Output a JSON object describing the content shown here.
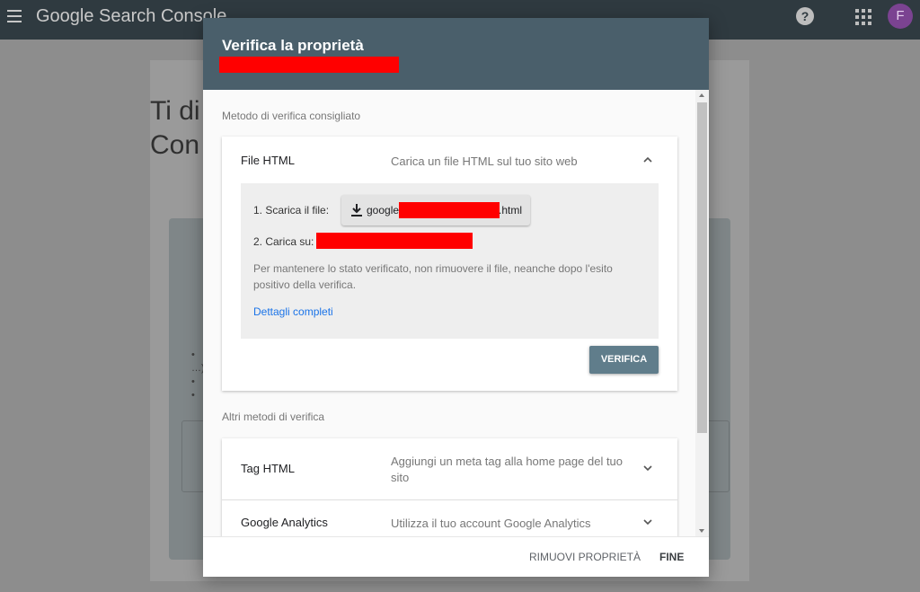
{
  "app": {
    "title": "Google Search Console",
    "avatar_letter": "F",
    "help_glyph": "?"
  },
  "background": {
    "heading_line1": "Ti di",
    "heading_line2": "Con"
  },
  "dialog": {
    "title": "Verifica la proprietà",
    "recommended_label": "Metodo di verifica consigliato",
    "other_label": "Altri metodi di verifica",
    "html_file": {
      "name": "File HTML",
      "description": "Carica un file HTML sul tuo sito web",
      "step1_label": "1. Scarica il file:",
      "download_prefix": "google",
      "download_suffix": ".html",
      "step2_label": "2. Carica su:",
      "note": "Per mantenere lo stato verificato, non rimuovere il file, neanche dopo l'esito positivo della verifica.",
      "details_link": "Dettagli completi",
      "verify_button": "VERIFICA"
    },
    "other_methods": [
      {
        "name": "Tag HTML",
        "description": "Aggiungi un meta tag alla home page del tuo sito"
      },
      {
        "name": "Google Analytics",
        "description": "Utilizza il tuo account Google Analytics"
      }
    ],
    "footer": {
      "remove_button": "RIMUOVI PROPRIETÀ",
      "done_button": "FINE"
    }
  },
  "colors": {
    "header": "#4a5f6b",
    "verify_button": "#607d8b",
    "link": "#1a73e8",
    "redaction": "#ff0000"
  }
}
